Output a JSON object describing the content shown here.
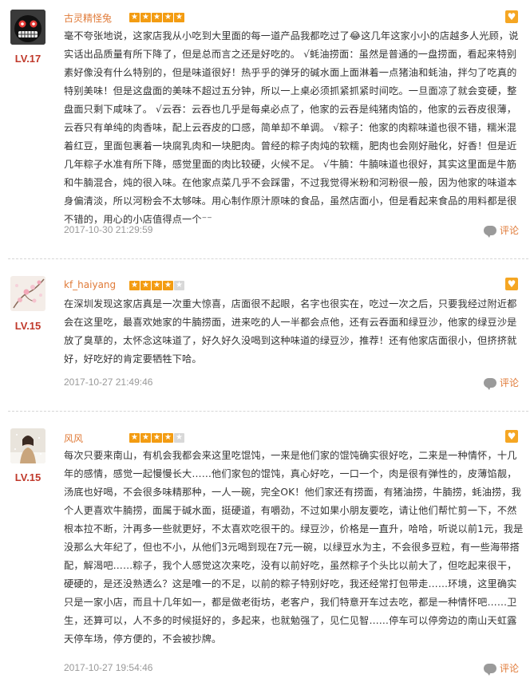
{
  "reviews": [
    {
      "username": "古灵精怪兔",
      "level": "LV.17",
      "rating": 5,
      "content": "毫不夸张地说，这家店我从小吃到大里面的每一道产品我都吃过了😂这几年这家小小的店越多人光顾，说实话出品质量有所下降了，但是总而言之还是好吃的。 √蚝油捞面：虽然是普通的一盘捞面，看起来特别素好像没有什么特别的，但是味道很好！热乎乎的弹牙的碱水面上面淋着一点猪油和蚝油，拌匀了吃真的特别美味！但是这盘面的美味不超过五分钟，所以一上桌必须抓紧抓紧时间吃。一旦面凉了就会变硬，整盘面只剩下咸味了。 √云吞：云吞也几乎是每桌必点了，他家的云吞是纯猪肉馅的，他家的云吞皮很薄，云吞只有单纯的肉香味，配上云吞皮的口感，简单却不单调。 √粽子：他家的肉粽味道也很不错，糯米混着红豆，里面包裹着一块腐乳肉和一块肥肉。曾经的粽子肉炖的软糯，肥肉也会刚好融化，好香！但是近几年粽子水准有所下降，感觉里面的肉比较硬，火候不足。 √牛腩：牛腩味道也很好，其实这里面是牛筋和牛腩混合，炖的很入味。在他家点菜几乎不会踩雷，不过我觉得米粉和河粉很一般，因为他家的味道本身偏清淡，所以河粉会不太够味。用心制作原汁原味的食品，虽然店面小，但是看起来食品的用料都是很不错的，用心的小店值得点一个⁻⁻",
      "date": "2017-10-30 21:29:59",
      "comment_label": "评论"
    },
    {
      "username": "kf_haiyang",
      "level": "LV.15",
      "rating": 4,
      "content": "在深圳发现这家店真是一次重大惊喜，店面很不起眼，名字也很实在，吃过一次之后，只要我经过附近都会在这里吃，最喜欢她家的牛腩捞面，进来吃的人一半都会点他，还有云吞面和绿豆沙，他家的绿豆沙是放了臭草的，太怀念这味道了，好久好久没喝到这种味道的绿豆沙，推荐！还有他家店面很小，但挤挤就好，好吃好的肯定要牺牲下哈。",
      "date": "2017-10-27 21:49:46",
      "comment_label": "评论"
    },
    {
      "username": "风风",
      "level": "LV.15",
      "rating": 4,
      "content": "每次只要来南山，有机会我都会来这里吃馄饨，一来是他们家的馄饨确实很好吃，二来是一种情怀，十几年的感情，感觉一起慢慢长大……他们家包的馄饨，真心好吃，一口一个，肉是很有弹性的，皮薄馅靓，汤底也好喝，不会很多味精那种，一人一碗，完全OK！他们家还有捞面，有猪油捞，牛腩捞，蚝油捞，我个人更喜欢牛腩捞，面属于碱水面，挺硬道，有嚼劲，不过如果小朋友要吃，请让他们帮忙剪一下，不然根本拉不断，汁再多一些就更好，不太喜欢吃很干的。绿豆沙，价格是一直升，哈哈，听说以前1元，我是没那么大年纪了，但也不小，从他们3元喝到现在7元一碗，以绿豆水为主，不会很多豆粒，有一些海带搭配，解渴吧……粽子，我个人感觉这次来吃，没有以前好吃，虽然粽子个头比以前大了，但吃起来很干，硬硬的，是还没熟透么？这是唯一的不足，以前的粽子特别好吃，我还经常打包带走……环境，这里确实只是一家小店，而且十几年如一，都是做老街坊，老客户，我们特意开车过去吃，都是一种情怀吧……卫生，还算可以，人不多的时候挺好的，多起来，也就勉强了，见仁见智……停车可以停旁边的南山天虹露天停车场，停方便的，不会被抄牌。",
      "date": "2017-10-27 19:54:46",
      "comment_label": "评论"
    }
  ],
  "colors": {
    "username": "#e07b39",
    "level": "#c0392b",
    "star_on": "#f39c12",
    "star_off": "#d8d8d8",
    "fav": "#f5a623",
    "date": "#999999"
  },
  "icons": {
    "avatar_1": "grinning-face-avatar",
    "avatar_2": "pink-blossom-avatar",
    "avatar_3": "girl-in-snow-avatar",
    "favorite": "heart-icon",
    "comment": "speech-bubble-icon"
  }
}
